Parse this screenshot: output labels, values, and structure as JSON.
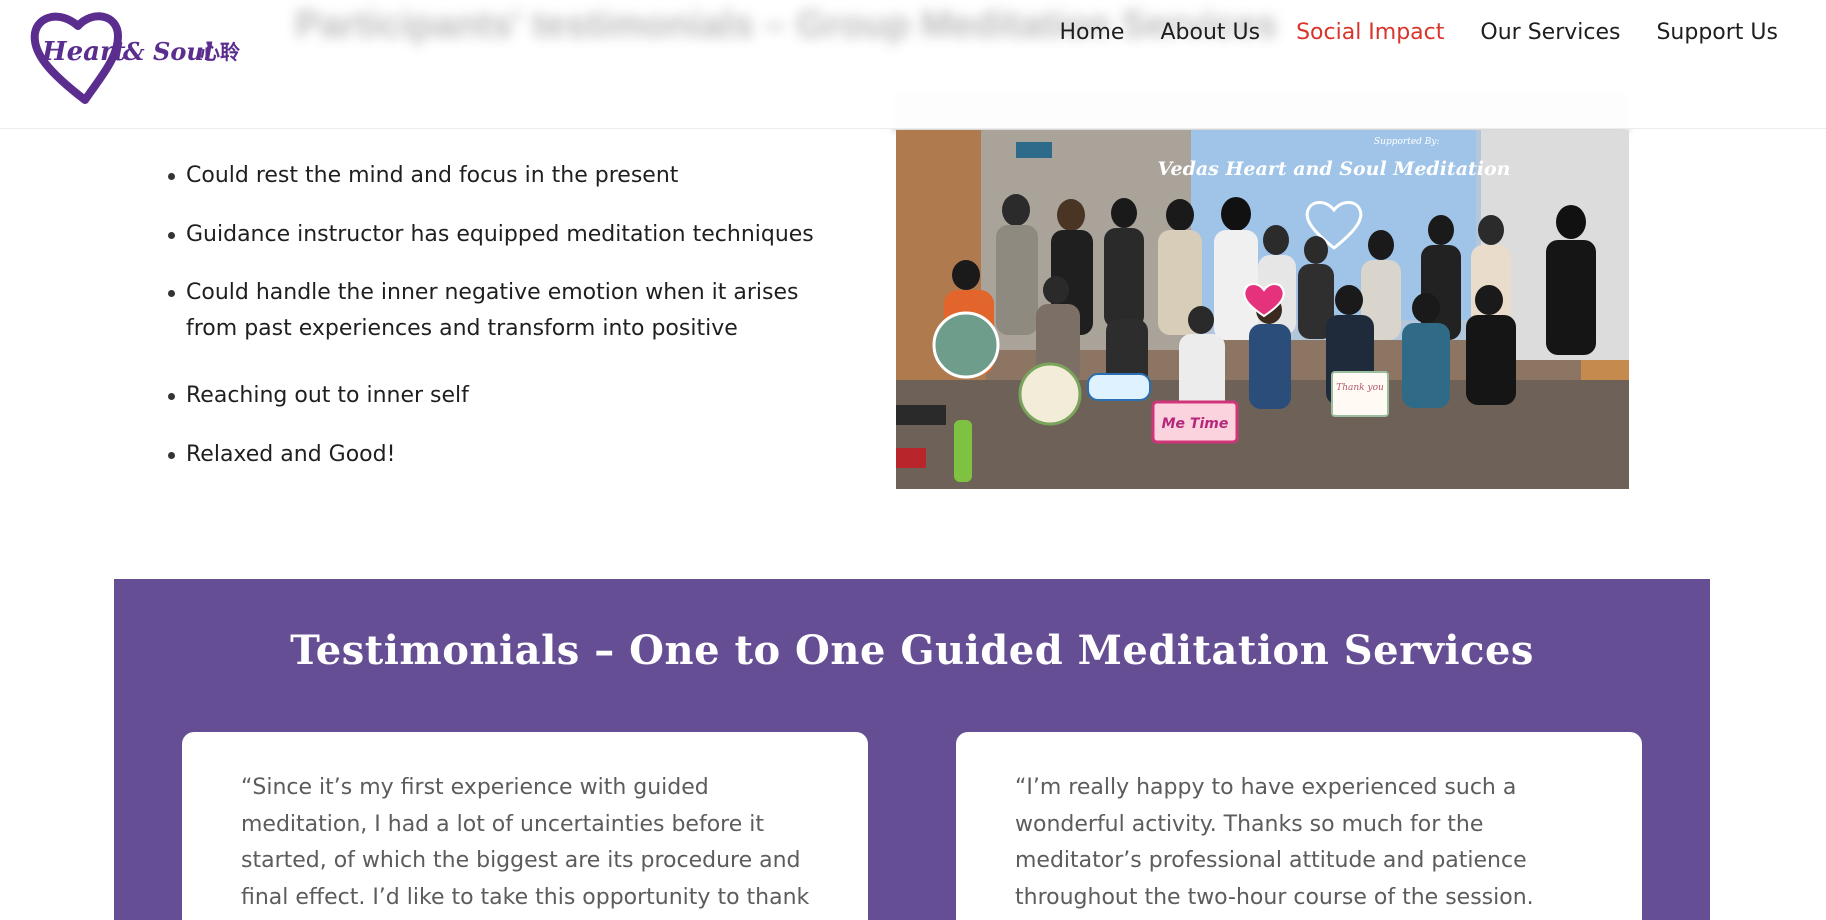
{
  "header": {
    "blurred_title": "Participants' testimonials – Group Meditation Services",
    "logo": {
      "text_main": "Heart",
      "text_amp": "& Soul",
      "text_cn": "心聆",
      "icon": "heart-icon",
      "color": "#5b2d8e"
    }
  },
  "nav": {
    "items": [
      {
        "label": "Home",
        "active": false
      },
      {
        "label": "About Us",
        "active": false
      },
      {
        "label": "Social Impact",
        "active": true
      },
      {
        "label": "Our Services",
        "active": false
      },
      {
        "label": "Support Us",
        "active": false
      }
    ],
    "active_color": "#d9342b"
  },
  "bullets": [
    "Could rest the mind and focus in the present",
    "Guidance instructor has equipped meditation techniques",
    "Could handle the inner negative emotion when it arises from past experiences and transform into positive",
    "Reaching out to inner self",
    "Relaxed and Good!"
  ],
  "photo": {
    "screen_title": "Vedas Heart and Soul Meditation",
    "screen_supported": "Supported By:",
    "sign_me_time": "Me Time",
    "sign_thank_you": "Thank you"
  },
  "testimonials": {
    "title": "Testimonials – One to One Guided Meditation Services",
    "background_color": "#654e94",
    "cards": [
      {
        "text": "“Since it’s my first experience with guided meditation, I had a lot of uncertainties before it started, of which the biggest are its procedure and final effect. I’d like to take this opportunity to thank the program director, Susana,"
      },
      {
        "text": "“I’m really happy to have experienced such a wonderful activity. Thanks so much for the meditator’s professional attitude and patience throughout the two-hour course of the session. Now I feel happier, more"
      }
    ]
  }
}
